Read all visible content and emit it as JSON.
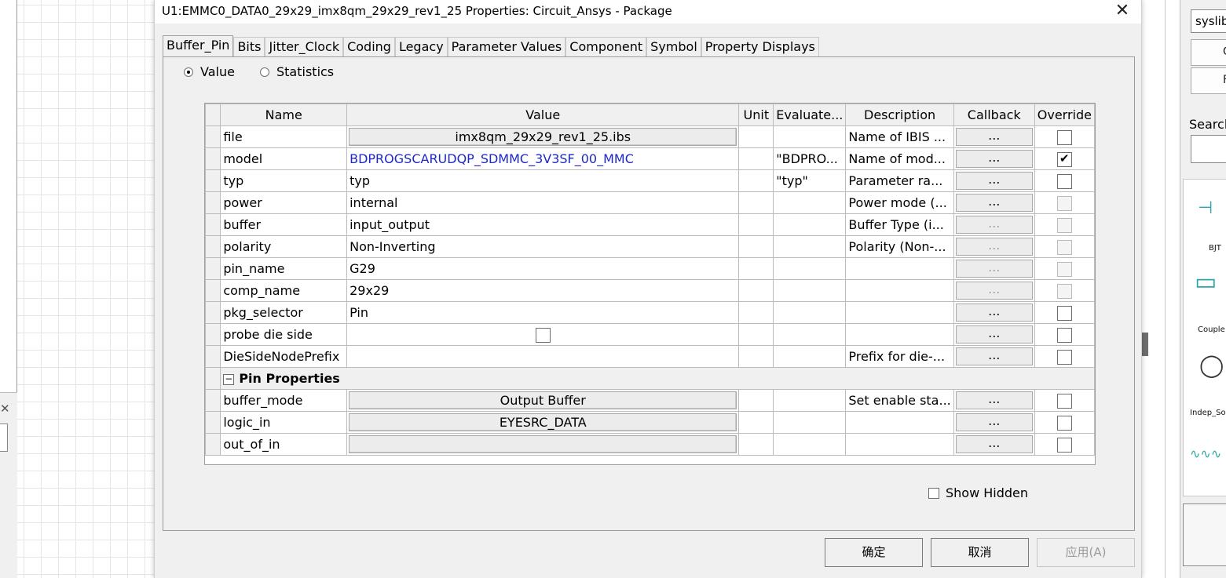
{
  "background": {
    "left_close_glyph": "✕",
    "library_field": "syslib_",
    "button_1_label": "G",
    "button_2_label": "F",
    "search_label": "Search",
    "palette": [
      {
        "label": "BJT",
        "icon": "bjt-icon"
      },
      {
        "label": "Couple",
        "icon": "coupler-icon"
      },
      {
        "label": "Indep_Sou",
        "icon": "source-icon"
      },
      {
        "label": "",
        "icon": "resistor-icon"
      }
    ]
  },
  "dialog": {
    "title": "U1:EMMC0_DATA0_29x29_imx8qm_29x29_rev1_25 Properties: Circuit_Ansys - Package",
    "close_glyph": "✕",
    "tabs": [
      {
        "label": "Buffer_Pin",
        "active": true
      },
      {
        "label": "Bits",
        "active": false
      },
      {
        "label": "Jitter_Clock",
        "active": false
      },
      {
        "label": "Coding",
        "active": false
      },
      {
        "label": "Legacy",
        "active": false
      },
      {
        "label": "Parameter Values",
        "active": false
      },
      {
        "label": "Component",
        "active": false
      },
      {
        "label": "Symbol",
        "active": false
      },
      {
        "label": "Property Displays",
        "active": false
      }
    ],
    "view_mode": {
      "value_label": "Value",
      "statistics_label": "Statistics",
      "selected": "Value"
    },
    "grid": {
      "columns": [
        "Name",
        "Value",
        "Unit",
        "Evaluate...",
        "Description",
        "Callback",
        "Override"
      ],
      "ellipsis": "...",
      "rows": [
        {
          "name": "file",
          "value": "imx8qm_29x29_rev1_25.ibs",
          "value_type": "button",
          "unit": "",
          "evaluated": "",
          "description": "Name of IBIS ...",
          "callback_enabled": true,
          "override": false,
          "override_enabled": true
        },
        {
          "name": "model",
          "value": "BDPROGSCARUDQP_SDMMC_3V3SF_00_MMC",
          "value_type": "link",
          "unit": "",
          "evaluated": "\"BDPRO...",
          "description": "Name of mod...",
          "callback_enabled": true,
          "override": true,
          "override_enabled": true
        },
        {
          "name": "typ",
          "value": "typ",
          "value_type": "text",
          "unit": "",
          "evaluated": "\"typ\"",
          "description": "Parameter ra...",
          "callback_enabled": true,
          "override": false,
          "override_enabled": true
        },
        {
          "name": "power",
          "value": "internal",
          "value_type": "text",
          "unit": "",
          "evaluated": "",
          "description": "Power mode (...",
          "callback_enabled": true,
          "override": false,
          "override_enabled": false
        },
        {
          "name": "buffer",
          "value": "input_output",
          "value_type": "text",
          "unit": "",
          "evaluated": "",
          "description": "Buffer Type (i...",
          "callback_enabled": false,
          "override": false,
          "override_enabled": false
        },
        {
          "name": "polarity",
          "value": "Non-Inverting",
          "value_type": "text",
          "unit": "",
          "evaluated": "",
          "description": "Polarity (Non-...",
          "callback_enabled": false,
          "override": false,
          "override_enabled": false
        },
        {
          "name": "pin_name",
          "value": "G29",
          "value_type": "text",
          "unit": "",
          "evaluated": "",
          "description": "",
          "callback_enabled": false,
          "override": false,
          "override_enabled": false
        },
        {
          "name": "comp_name",
          "value": "29x29",
          "value_type": "text",
          "unit": "",
          "evaluated": "",
          "description": "",
          "callback_enabled": false,
          "override": false,
          "override_enabled": false
        },
        {
          "name": "pkg_selector",
          "value": "Pin",
          "value_type": "text",
          "unit": "",
          "evaluated": "",
          "description": "",
          "callback_enabled": true,
          "override": false,
          "override_enabled": true
        },
        {
          "name": "probe die side",
          "value": "",
          "value_type": "checkbox",
          "unit": "",
          "evaluated": "",
          "description": "",
          "callback_enabled": true,
          "override": false,
          "override_enabled": true
        },
        {
          "name": "DieSideNodePrefix",
          "value": "",
          "value_type": "text",
          "unit": "",
          "evaluated": "",
          "description": "Prefix for die-...",
          "callback_enabled": true,
          "override": false,
          "override_enabled": true
        }
      ],
      "section": {
        "label": "Pin Properties",
        "expander": "−"
      },
      "section_rows": [
        {
          "name": "buffer_mode",
          "value": "Output Buffer",
          "value_type": "button",
          "unit": "",
          "evaluated": "",
          "description": "Set enable sta...",
          "callback_enabled": true,
          "override": false,
          "override_enabled": true
        },
        {
          "name": "logic_in",
          "value": "EYESRC_DATA",
          "value_type": "button",
          "unit": "",
          "evaluated": "",
          "description": "",
          "callback_enabled": true,
          "override": false,
          "override_enabled": true
        },
        {
          "name": "out_of_in",
          "value": "",
          "value_type": "button",
          "unit": "",
          "evaluated": "",
          "description": "",
          "callback_enabled": true,
          "override": false,
          "override_enabled": true
        }
      ]
    },
    "show_hidden": {
      "label": "Show Hidden",
      "checked": false
    },
    "footer": {
      "ok_label": "确定",
      "cancel_label": "取消",
      "apply_label": "应用(A)"
    }
  }
}
